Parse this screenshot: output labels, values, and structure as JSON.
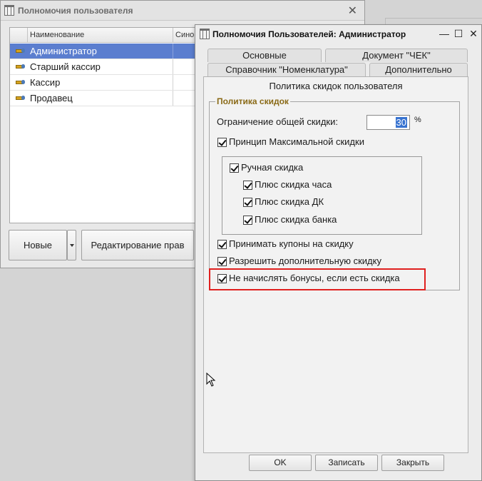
{
  "background_window": {
    "title": "Полномочия пользователя",
    "columns": [
      "Наименование",
      "Синон"
    ],
    "rows": [
      {
        "name": "Администратор",
        "selected": true
      },
      {
        "name": "Старший кассир",
        "selected": false
      },
      {
        "name": "Кассир",
        "selected": false
      },
      {
        "name": "Продавец",
        "selected": false
      }
    ],
    "buttons": {
      "new": "Новые",
      "edit": "Редактирование прав"
    }
  },
  "dialog": {
    "title": "Полномочия Пользователей: Администратор",
    "tabs": [
      "Основные",
      "Документ \"ЧЕК\"",
      "Справочник \"Номенклатура\"",
      "Дополнительно"
    ],
    "panel_title": "Политика скидок пользователя",
    "group_title": "Политика скидок",
    "limit_label": "Ограничение общей скидки:",
    "limit_value": "30",
    "limit_unit": "%",
    "checkboxes": {
      "max_discount": {
        "label": "Принцип Максимальной скидки",
        "checked": true
      },
      "manual": {
        "label": "Ручная скидка",
        "checked": true
      },
      "plus_hour": {
        "label": "Плюс скидка часа",
        "checked": true
      },
      "plus_dk": {
        "label": "Плюс скидка ДК",
        "checked": true
      },
      "plus_bank": {
        "label": "Плюс скидка банка",
        "checked": true
      },
      "coupons": {
        "label": "Принимать купоны на скидку",
        "checked": true
      },
      "allow_extra": {
        "label": "Разрешить дополнительную скидку",
        "checked": true
      },
      "no_bonus": {
        "label": "Не начислять бонусы, если есть скидка",
        "checked": true
      }
    },
    "buttons": {
      "ok": "OK",
      "save": "Записать",
      "close": "Закрыть"
    }
  },
  "colors": {
    "selection": "#5b7ecf",
    "highlight_border": "#e0201f",
    "group_title": "#8a6a17",
    "input_selection": "#3873d0"
  }
}
